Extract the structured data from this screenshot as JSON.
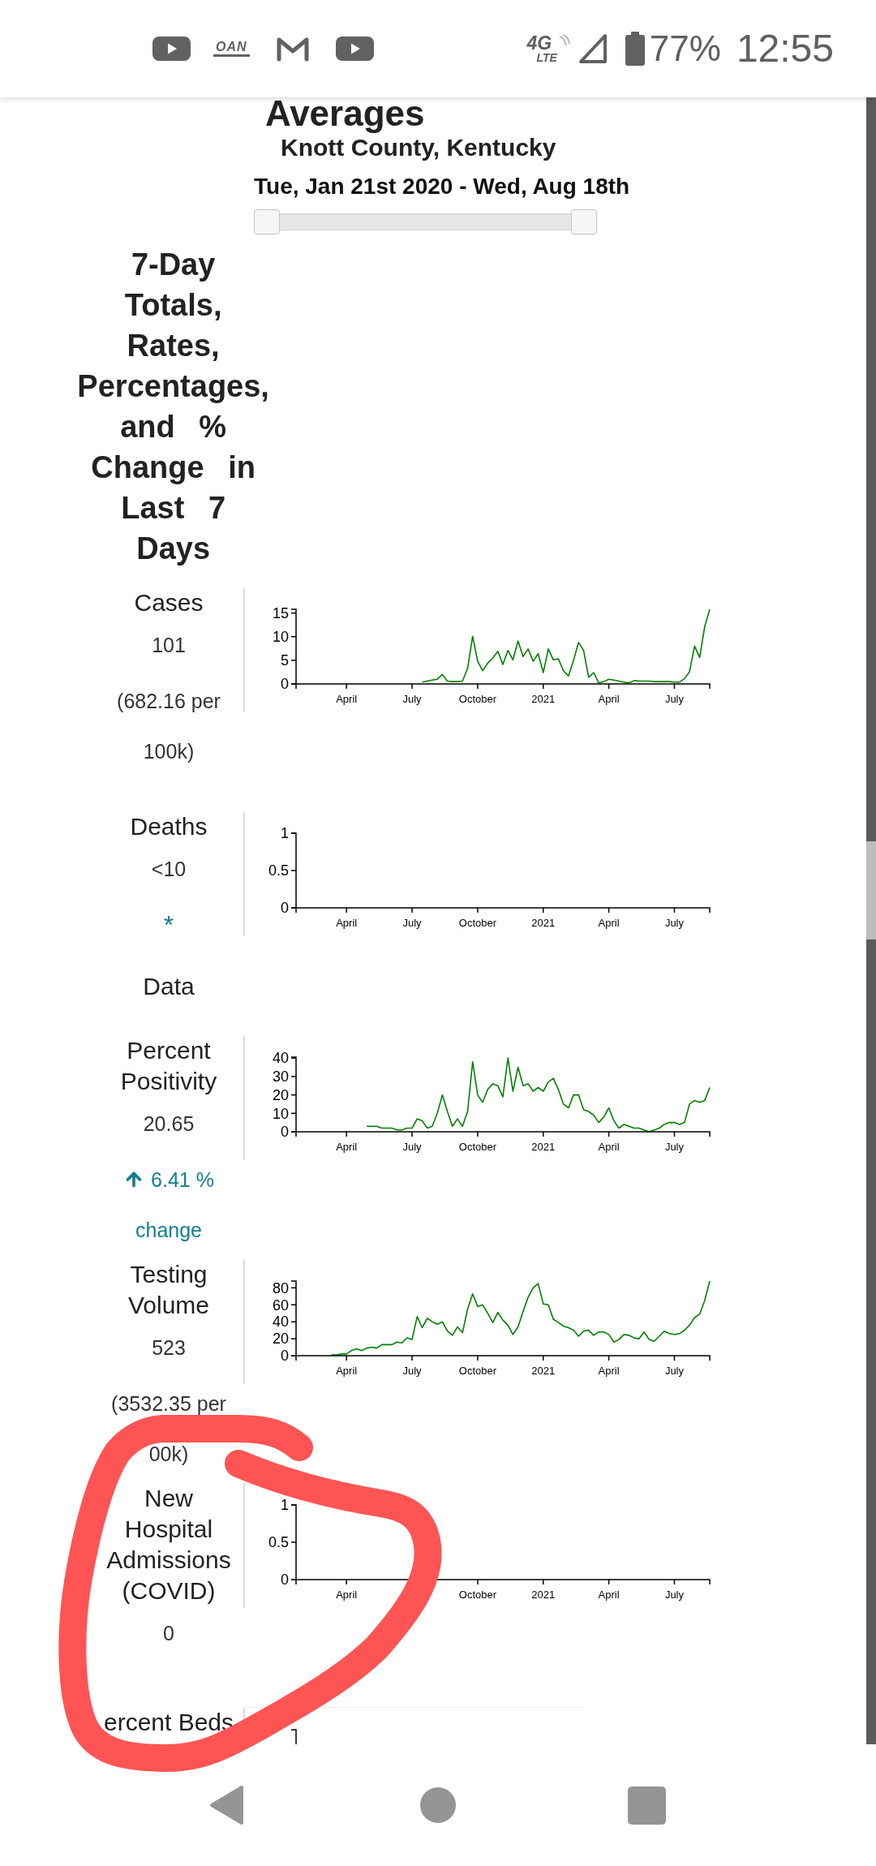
{
  "status_bar": {
    "app_logo_text": "OAN",
    "network_generation": "4G",
    "network_type": "LTE",
    "battery": "77%",
    "time": "12:55"
  },
  "header": {
    "title": "Averages",
    "location": "Knott County, Kentucky",
    "date_range": "Tue, Jan 21st 2020 - Wed, Aug 18th"
  },
  "date_slider": {
    "handles": [
      {
        "level": 0
      },
      {
        "level": 1
      }
    ]
  },
  "section_title": "7-Day Totals, Rates, Percentages, and % Change in Last 7 Days",
  "metrics": [
    {
      "label": "Cases",
      "value": "101",
      "lines": [
        {
          "kind": "text",
          "text": "(682.16 per 100k)"
        }
      ],
      "chart_data": {
        "type": "line",
        "ylim": [
          0,
          15.8
        ],
        "yticks": [
          0,
          5,
          10,
          15
        ],
        "categories": [
          null,
          null,
          null,
          null,
          null,
          null,
          null,
          null,
          null,
          null,
          "April",
          null,
          null,
          null,
          null,
          null,
          null,
          null,
          null,
          null,
          null,
          null,
          null,
          "July",
          null,
          null,
          null,
          null,
          null,
          null,
          null,
          null,
          null,
          null,
          null,
          null,
          "October",
          null,
          null,
          null,
          null,
          null,
          null,
          null,
          null,
          null,
          null,
          null,
          null,
          "2021",
          null,
          null,
          null,
          null,
          null,
          null,
          null,
          null,
          null,
          null,
          null,
          null,
          "April",
          null,
          null,
          null,
          null,
          null,
          null,
          null,
          null,
          null,
          null,
          null,
          null,
          "July",
          null,
          null,
          null,
          null,
          null,
          null,
          null
        ],
        "series": [
          {
            "color": "#008000",
            "values": [
              null,
              null,
              null,
              null,
              null,
              null,
              null,
              null,
              null,
              null,
              null,
              null,
              null,
              null,
              null,
              null,
              null,
              null,
              null,
              null,
              null,
              null,
              null,
              null,
              null,
              0.4,
              0.6,
              0.8,
              1.0,
              2.0,
              0.6,
              0.5,
              0.5,
              0.6,
              3.3,
              10.1,
              4.8,
              2.8,
              4.4,
              5.5,
              6.9,
              4.1,
              7.1,
              5.1,
              9.1,
              5.8,
              7.4,
              4.8,
              6.4,
              2.4,
              7.4,
              5.1,
              5.3,
              2.8,
              1.7,
              5.0,
              8.8,
              7.1,
              1.4,
              2.4,
              0.2,
              0.5,
              1.0,
              0.8,
              0.6,
              0.4,
              0.2,
              0.7,
              0.6,
              0.6,
              0.6,
              0.5,
              0.5,
              0.5,
              0.5,
              0.4,
              0.4,
              1.1,
              2.6,
              8.0,
              5.6,
              12.1,
              15.8
            ]
          }
        ]
      }
    },
    {
      "label": "Deaths",
      "value": "<10",
      "lines": [
        {
          "kind": "link",
          "text": "*"
        },
        {
          "kind": "note",
          "text": "Data"
        }
      ],
      "chart_data": {
        "type": "line",
        "ylim": [
          0,
          1
        ],
        "yticks": [
          0,
          0.5,
          1
        ],
        "categories": [
          null,
          null,
          null,
          null,
          null,
          null,
          null,
          null,
          null,
          null,
          "April",
          null,
          null,
          null,
          null,
          null,
          null,
          null,
          null,
          null,
          null,
          null,
          null,
          "July",
          null,
          null,
          null,
          null,
          null,
          null,
          null,
          null,
          null,
          null,
          null,
          null,
          "October",
          null,
          null,
          null,
          null,
          null,
          null,
          null,
          null,
          null,
          null,
          null,
          null,
          "2021",
          null,
          null,
          null,
          null,
          null,
          null,
          null,
          null,
          null,
          null,
          null,
          null,
          "April",
          null,
          null,
          null,
          null,
          null,
          null,
          null,
          null,
          null,
          null,
          null,
          null,
          "July",
          null,
          null,
          null,
          null,
          null,
          null,
          null
        ]
      }
    },
    {
      "label": "Percent Positivity",
      "value": "20.65",
      "lines": [
        {
          "kind": "change",
          "rising": true,
          "text": "6.41 % change"
        }
      ],
      "chart_data": {
        "type": "line",
        "ylim": [
          0,
          40.5
        ],
        "yticks": [
          0,
          10,
          20,
          30,
          40
        ],
        "categories": [
          null,
          null,
          null,
          null,
          null,
          null,
          null,
          null,
          null,
          null,
          "April",
          null,
          null,
          null,
          null,
          null,
          null,
          null,
          null,
          null,
          null,
          null,
          null,
          "July",
          null,
          null,
          null,
          null,
          null,
          null,
          null,
          null,
          null,
          null,
          null,
          null,
          "October",
          null,
          null,
          null,
          null,
          null,
          null,
          null,
          null,
          null,
          null,
          null,
          null,
          "2021",
          null,
          null,
          null,
          null,
          null,
          null,
          null,
          null,
          null,
          null,
          null,
          null,
          "April",
          null,
          null,
          null,
          null,
          null,
          null,
          null,
          null,
          null,
          null,
          null,
          null,
          "July",
          null,
          null,
          null,
          null,
          null,
          null,
          null
        ],
        "series": [
          {
            "color": "#008000",
            "values": [
              null,
              null,
              null,
              null,
              null,
              null,
              null,
              null,
              null,
              null,
              null,
              null,
              null,
              null,
              3,
              3,
              3,
              2,
              2,
              2,
              1,
              1,
              2,
              2,
              7,
              6,
              2,
              3,
              10,
              20,
              11,
              3,
              7,
              3,
              11,
              38,
              20,
              16,
              23,
              26,
              25,
              19,
              40,
              22,
              35,
              25,
              26,
              22,
              24,
              22,
              27,
              29,
              23,
              15,
              13,
              20,
              20,
              12,
              11,
              9,
              5,
              8,
              13,
              6,
              2,
              4,
              3,
              2,
              2,
              1,
              0,
              1,
              2,
              4,
              5,
              5,
              4,
              5,
              15,
              17,
              16,
              17,
              24
            ]
          }
        ]
      }
    },
    {
      "label": "Testing Volume",
      "value": "523",
      "lines": [
        {
          "kind": "text",
          "text": "(3532.35 per 00k)"
        }
      ],
      "chart_data": {
        "type": "line",
        "ylim": [
          0,
          88
        ],
        "yticks": [
          0,
          20,
          40,
          60,
          80
        ],
        "categories": [
          null,
          null,
          null,
          null,
          null,
          null,
          null,
          null,
          null,
          null,
          "April",
          null,
          null,
          null,
          null,
          null,
          null,
          null,
          null,
          null,
          null,
          null,
          null,
          "July",
          null,
          null,
          null,
          null,
          null,
          null,
          null,
          null,
          null,
          null,
          null,
          null,
          "October",
          null,
          null,
          null,
          null,
          null,
          null,
          null,
          null,
          null,
          null,
          null,
          null,
          "2021",
          null,
          null,
          null,
          null,
          null,
          null,
          null,
          null,
          null,
          null,
          null,
          null,
          "April",
          null,
          null,
          null,
          null,
          null,
          null,
          null,
          null,
          null,
          null,
          null,
          null,
          "July",
          null,
          null,
          null,
          null,
          null,
          null,
          null
        ],
        "series": [
          {
            "color": "#008000",
            "values": [
              null,
              null,
              null,
              null,
              null,
              null,
              null,
              1,
              1,
              2,
              2,
              6,
              8,
              6,
              9,
              10,
              9,
              13,
              13,
              13,
              16,
              15,
              21,
              19,
              46,
              33,
              44,
              40,
              37,
              40,
              29,
              24,
              34,
              27,
              55,
              73,
              58,
              60,
              50,
              39,
              51,
              42,
              36,
              25,
              34,
              52,
              69,
              80,
              85,
              61,
              60,
              43,
              39,
              35,
              33,
              30,
              23,
              29,
              30,
              24,
              28,
              28,
              25,
              16,
              19,
              25,
              24,
              21,
              20,
              28,
              19,
              17,
              23,
              29,
              26,
              25,
              26,
              30,
              36,
              45,
              49,
              65,
              88
            ]
          }
        ]
      }
    },
    {
      "label": "New Hospital Admissions (COVID)",
      "value": "0",
      "chart_data": {
        "type": "line",
        "ylim": [
          0,
          1
        ],
        "yticks": [
          0,
          0.5,
          1
        ],
        "categories": [
          null,
          null,
          null,
          null,
          null,
          null,
          null,
          null,
          null,
          null,
          "April",
          null,
          null,
          null,
          null,
          null,
          null,
          null,
          null,
          null,
          null,
          null,
          null,
          null,
          null,
          null,
          null,
          null,
          null,
          null,
          null,
          null,
          null,
          null,
          null,
          null,
          "October",
          null,
          null,
          null,
          null,
          null,
          null,
          null,
          null,
          null,
          null,
          null,
          null,
          "2021",
          null,
          null,
          null,
          null,
          null,
          null,
          null,
          null,
          null,
          null,
          null,
          null,
          "April",
          null,
          null,
          null,
          null,
          null,
          null,
          null,
          null,
          null,
          null,
          null,
          null,
          "July",
          null,
          null,
          null,
          null,
          null,
          null,
          null
        ]
      }
    },
    {
      "label": "ercent Beds"
    }
  ]
}
